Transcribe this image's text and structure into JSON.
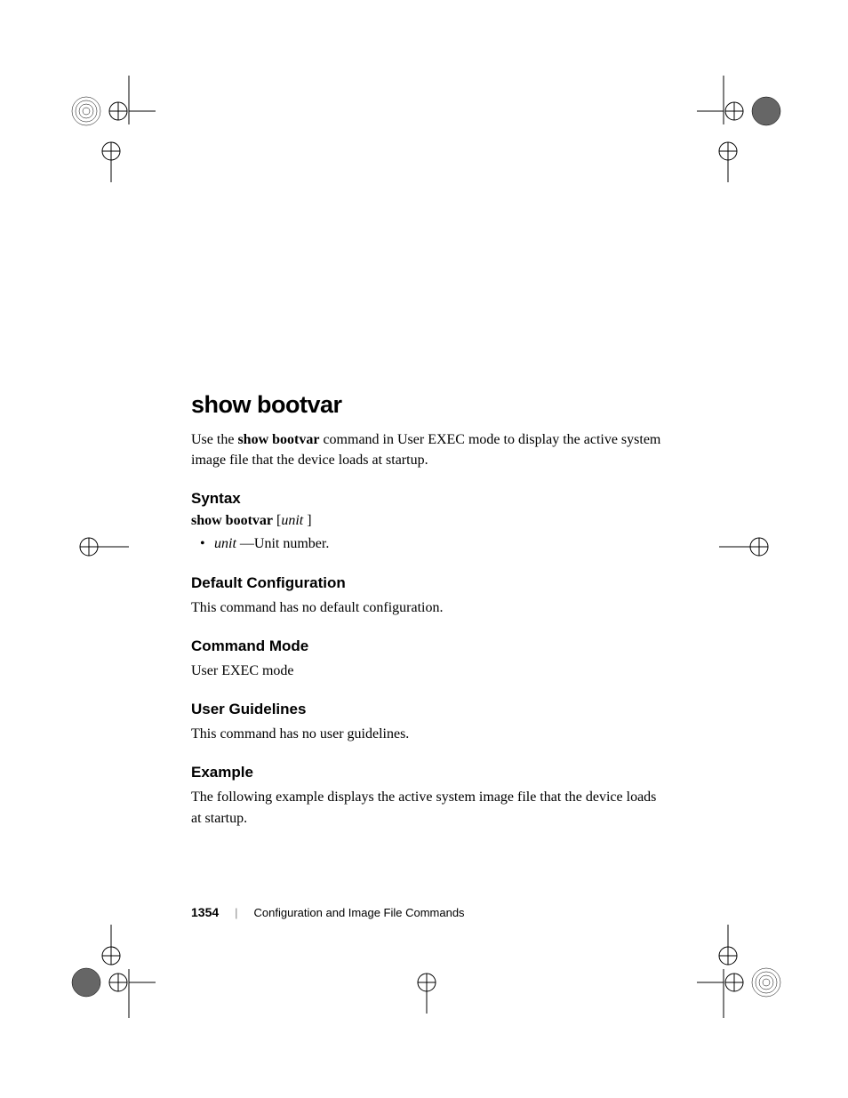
{
  "heading": "show bootvar",
  "intro_prefix": "Use the ",
  "intro_bold": "show bootvar",
  "intro_suffix": " command in User EXEC mode to display the active system image file that the device loads at startup.",
  "syntax": {
    "heading": "Syntax",
    "cmd_bold": "show bootvar",
    "cmd_bracket_open": " [",
    "cmd_italic": "unit",
    "cmd_bracket_close": " ]",
    "bullet_italic": "unit",
    "bullet_suffix": " —Unit number."
  },
  "default_config": {
    "heading": "Default Configuration",
    "text": "This command has no default configuration."
  },
  "command_mode": {
    "heading": "Command Mode",
    "text": "User EXEC mode"
  },
  "user_guidelines": {
    "heading": "User Guidelines",
    "text": "This command has no user guidelines."
  },
  "example": {
    "heading": "Example",
    "text": "The following example displays the active system image file that the device loads at startup."
  },
  "footer": {
    "page_number": "1354",
    "separator": "|",
    "title": "Configuration and Image File Commands"
  }
}
